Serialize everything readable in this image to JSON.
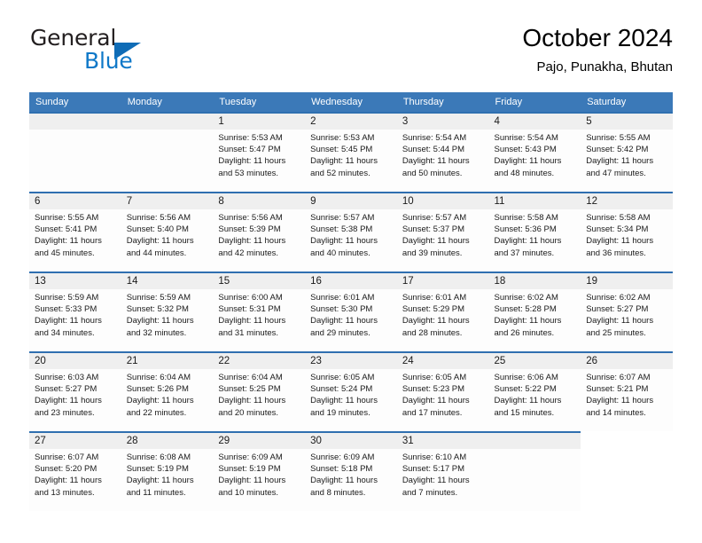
{
  "brand": {
    "name_top": "General",
    "name_bottom": "Blue",
    "triangle_color": "#0f6cb6",
    "blue_color": "#0f78c8"
  },
  "header": {
    "title": "October 2024",
    "subtitle": "Pajo, Punakha, Bhutan"
  },
  "colors": {
    "header_row_background": "#3b79b8",
    "day_band_background": "#efefef",
    "cell_top_border": "#2f6fb0",
    "text": "#1a1a1a"
  },
  "weekday_headers": [
    "Sunday",
    "Monday",
    "Tuesday",
    "Wednesday",
    "Thursday",
    "Friday",
    "Saturday"
  ],
  "labels": {
    "sunrise_prefix": "Sunrise: ",
    "sunset_prefix": "Sunset: ",
    "daylight_prefix": "Daylight: "
  },
  "weeks": [
    [
      {
        "day": "",
        "sunrise": "",
        "sunset": "",
        "daylight": "",
        "state": "blank-lead"
      },
      {
        "day": "",
        "sunrise": "",
        "sunset": "",
        "daylight": "",
        "state": "blank-lead"
      },
      {
        "day": "1",
        "sunrise": "Sunrise: 5:53 AM",
        "sunset": "Sunset: 5:47 PM",
        "daylight": "Daylight: 11 hours and 53 minutes.",
        "state": "filled"
      },
      {
        "day": "2",
        "sunrise": "Sunrise: 5:53 AM",
        "sunset": "Sunset: 5:45 PM",
        "daylight": "Daylight: 11 hours and 52 minutes.",
        "state": "filled"
      },
      {
        "day": "3",
        "sunrise": "Sunrise: 5:54 AM",
        "sunset": "Sunset: 5:44 PM",
        "daylight": "Daylight: 11 hours and 50 minutes.",
        "state": "filled"
      },
      {
        "day": "4",
        "sunrise": "Sunrise: 5:54 AM",
        "sunset": "Sunset: 5:43 PM",
        "daylight": "Daylight: 11 hours and 48 minutes.",
        "state": "filled"
      },
      {
        "day": "5",
        "sunrise": "Sunrise: 5:55 AM",
        "sunset": "Sunset: 5:42 PM",
        "daylight": "Daylight: 11 hours and 47 minutes.",
        "state": "filled"
      }
    ],
    [
      {
        "day": "6",
        "sunrise": "Sunrise: 5:55 AM",
        "sunset": "Sunset: 5:41 PM",
        "daylight": "Daylight: 11 hours and 45 minutes.",
        "state": "filled"
      },
      {
        "day": "7",
        "sunrise": "Sunrise: 5:56 AM",
        "sunset": "Sunset: 5:40 PM",
        "daylight": "Daylight: 11 hours and 44 minutes.",
        "state": "filled"
      },
      {
        "day": "8",
        "sunrise": "Sunrise: 5:56 AM",
        "sunset": "Sunset: 5:39 PM",
        "daylight": "Daylight: 11 hours and 42 minutes.",
        "state": "filled"
      },
      {
        "day": "9",
        "sunrise": "Sunrise: 5:57 AM",
        "sunset": "Sunset: 5:38 PM",
        "daylight": "Daylight: 11 hours and 40 minutes.",
        "state": "filled"
      },
      {
        "day": "10",
        "sunrise": "Sunrise: 5:57 AM",
        "sunset": "Sunset: 5:37 PM",
        "daylight": "Daylight: 11 hours and 39 minutes.",
        "state": "filled"
      },
      {
        "day": "11",
        "sunrise": "Sunrise: 5:58 AM",
        "sunset": "Sunset: 5:36 PM",
        "daylight": "Daylight: 11 hours and 37 minutes.",
        "state": "filled"
      },
      {
        "day": "12",
        "sunrise": "Sunrise: 5:58 AM",
        "sunset": "Sunset: 5:34 PM",
        "daylight": "Daylight: 11 hours and 36 minutes.",
        "state": "filled"
      }
    ],
    [
      {
        "day": "13",
        "sunrise": "Sunrise: 5:59 AM",
        "sunset": "Sunset: 5:33 PM",
        "daylight": "Daylight: 11 hours and 34 minutes.",
        "state": "filled"
      },
      {
        "day": "14",
        "sunrise": "Sunrise: 5:59 AM",
        "sunset": "Sunset: 5:32 PM",
        "daylight": "Daylight: 11 hours and 32 minutes.",
        "state": "filled"
      },
      {
        "day": "15",
        "sunrise": "Sunrise: 6:00 AM",
        "sunset": "Sunset: 5:31 PM",
        "daylight": "Daylight: 11 hours and 31 minutes.",
        "state": "filled"
      },
      {
        "day": "16",
        "sunrise": "Sunrise: 6:01 AM",
        "sunset": "Sunset: 5:30 PM",
        "daylight": "Daylight: 11 hours and 29 minutes.",
        "state": "filled"
      },
      {
        "day": "17",
        "sunrise": "Sunrise: 6:01 AM",
        "sunset": "Sunset: 5:29 PM",
        "daylight": "Daylight: 11 hours and 28 minutes.",
        "state": "filled"
      },
      {
        "day": "18",
        "sunrise": "Sunrise: 6:02 AM",
        "sunset": "Sunset: 5:28 PM",
        "daylight": "Daylight: 11 hours and 26 minutes.",
        "state": "filled"
      },
      {
        "day": "19",
        "sunrise": "Sunrise: 6:02 AM",
        "sunset": "Sunset: 5:27 PM",
        "daylight": "Daylight: 11 hours and 25 minutes.",
        "state": "filled"
      }
    ],
    [
      {
        "day": "20",
        "sunrise": "Sunrise: 6:03 AM",
        "sunset": "Sunset: 5:27 PM",
        "daylight": "Daylight: 11 hours and 23 minutes.",
        "state": "filled"
      },
      {
        "day": "21",
        "sunrise": "Sunrise: 6:04 AM",
        "sunset": "Sunset: 5:26 PM",
        "daylight": "Daylight: 11 hours and 22 minutes.",
        "state": "filled"
      },
      {
        "day": "22",
        "sunrise": "Sunrise: 6:04 AM",
        "sunset": "Sunset: 5:25 PM",
        "daylight": "Daylight: 11 hours and 20 minutes.",
        "state": "filled"
      },
      {
        "day": "23",
        "sunrise": "Sunrise: 6:05 AM",
        "sunset": "Sunset: 5:24 PM",
        "daylight": "Daylight: 11 hours and 19 minutes.",
        "state": "filled"
      },
      {
        "day": "24",
        "sunrise": "Sunrise: 6:05 AM",
        "sunset": "Sunset: 5:23 PM",
        "daylight": "Daylight: 11 hours and 17 minutes.",
        "state": "filled"
      },
      {
        "day": "25",
        "sunrise": "Sunrise: 6:06 AM",
        "sunset": "Sunset: 5:22 PM",
        "daylight": "Daylight: 11 hours and 15 minutes.",
        "state": "filled"
      },
      {
        "day": "26",
        "sunrise": "Sunrise: 6:07 AM",
        "sunset": "Sunset: 5:21 PM",
        "daylight": "Daylight: 11 hours and 14 minutes.",
        "state": "filled"
      }
    ],
    [
      {
        "day": "27",
        "sunrise": "Sunrise: 6:07 AM",
        "sunset": "Sunset: 5:20 PM",
        "daylight": "Daylight: 11 hours and 13 minutes.",
        "state": "filled"
      },
      {
        "day": "28",
        "sunrise": "Sunrise: 6:08 AM",
        "sunset": "Sunset: 5:19 PM",
        "daylight": "Daylight: 11 hours and 11 minutes.",
        "state": "filled"
      },
      {
        "day": "29",
        "sunrise": "Sunrise: 6:09 AM",
        "sunset": "Sunset: 5:19 PM",
        "daylight": "Daylight: 11 hours and 10 minutes.",
        "state": "filled"
      },
      {
        "day": "30",
        "sunrise": "Sunrise: 6:09 AM",
        "sunset": "Sunset: 5:18 PM",
        "daylight": "Daylight: 11 hours and 8 minutes.",
        "state": "filled"
      },
      {
        "day": "31",
        "sunrise": "Sunrise: 6:10 AM",
        "sunset": "Sunset: 5:17 PM",
        "daylight": "Daylight: 11 hours and 7 minutes.",
        "state": "filled"
      },
      {
        "day": "",
        "sunrise": "",
        "sunset": "",
        "daylight": "",
        "state": "blank-lead"
      },
      {
        "day": "",
        "sunrise": "",
        "sunset": "",
        "daylight": "",
        "state": "empty-trail"
      }
    ]
  ]
}
